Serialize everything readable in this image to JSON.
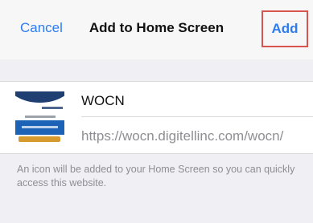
{
  "navbar": {
    "cancel_label": "Cancel",
    "title": "Add to Home Screen",
    "add_label": "Add",
    "accent_color": "#2f7bf0",
    "highlight_color": "#d9534f"
  },
  "shortcut": {
    "name": "WOCN",
    "url": "https://wocn.digitellinc.com/wocn/",
    "icon": "wocn-site-thumbnail-icon"
  },
  "footer": {
    "note": "An icon will be added to your Home Screen so you can quickly access this website."
  }
}
